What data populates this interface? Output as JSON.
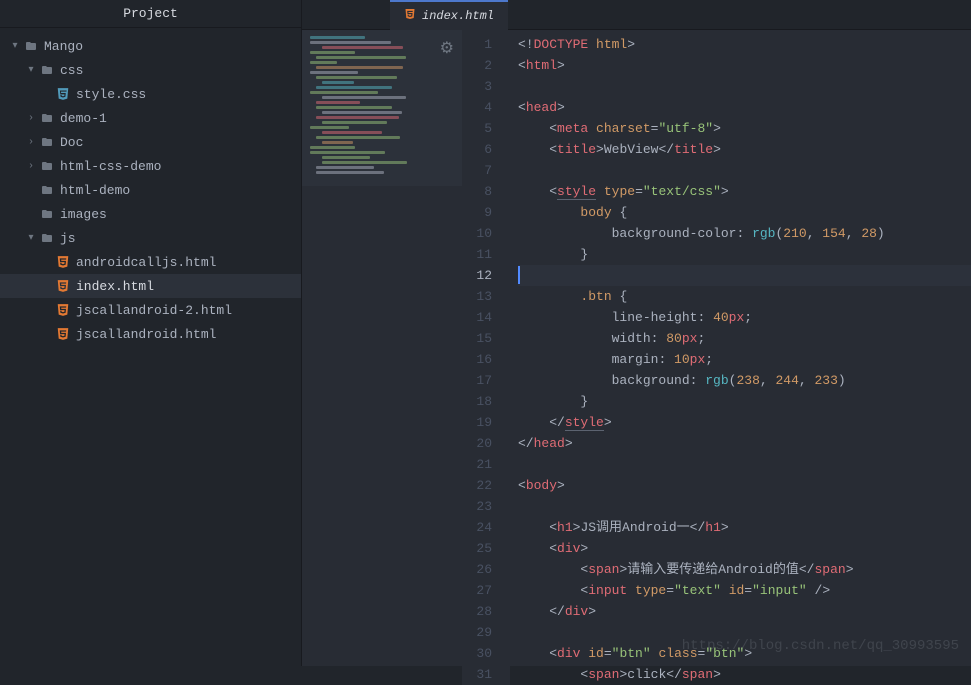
{
  "sidebar": {
    "title": "Project",
    "items": [
      {
        "label": "Mango",
        "type": "folder",
        "indent": 0,
        "expanded": true,
        "chev": "▾"
      },
      {
        "label": "css",
        "type": "folder",
        "indent": 1,
        "expanded": true,
        "chev": "▾"
      },
      {
        "label": "style.css",
        "type": "css",
        "indent": 2,
        "chev": ""
      },
      {
        "label": "demo-1",
        "type": "folder",
        "indent": 1,
        "expanded": false,
        "chev": "›"
      },
      {
        "label": "Doc",
        "type": "folder",
        "indent": 1,
        "expanded": false,
        "chev": "›"
      },
      {
        "label": "html-css-demo",
        "type": "folder",
        "indent": 1,
        "expanded": false,
        "chev": "›"
      },
      {
        "label": "html-demo",
        "type": "folder",
        "indent": 1,
        "expanded": false,
        "chev": ""
      },
      {
        "label": "images",
        "type": "folder",
        "indent": 1,
        "expanded": false,
        "chev": ""
      },
      {
        "label": "js",
        "type": "folder",
        "indent": 1,
        "expanded": true,
        "chev": "▾"
      },
      {
        "label": "androidcalljs.html",
        "type": "html",
        "indent": 2,
        "chev": ""
      },
      {
        "label": "index.html",
        "type": "html",
        "indent": 2,
        "chev": "",
        "selected": true
      },
      {
        "label": "jscallandroid-2.html",
        "type": "html",
        "indent": 2,
        "chev": ""
      },
      {
        "label": "jscallandroid.html",
        "type": "html",
        "indent": 2,
        "chev": ""
      }
    ]
  },
  "tab": {
    "label": "index.html"
  },
  "editor": {
    "current_line": 12,
    "lines": [
      {
        "n": 1,
        "t": "<!DOCTYPE html>",
        "seg": [
          [
            "<!",
            "p"
          ],
          [
            "DOCTYPE ",
            "t"
          ],
          [
            "html",
            "a"
          ],
          [
            ">",
            "p"
          ]
        ]
      },
      {
        "n": 2,
        "t": "<html>",
        "seg": [
          [
            "<",
            "p"
          ],
          [
            "html",
            "t"
          ],
          [
            ">",
            "p"
          ]
        ]
      },
      {
        "n": 3,
        "t": "",
        "seg": []
      },
      {
        "n": 4,
        "t": "<head>",
        "seg": [
          [
            "<",
            "p"
          ],
          [
            "head",
            "t"
          ],
          [
            ">",
            "p"
          ]
        ]
      },
      {
        "n": 5,
        "t": "    <meta charset=\"utf-8\">",
        "seg": [
          [
            "    <",
            "p"
          ],
          [
            "meta ",
            "t"
          ],
          [
            "charset",
            "a"
          ],
          [
            "=",
            "p"
          ],
          [
            "\"utf-8\"",
            "s"
          ],
          [
            ">",
            "p"
          ]
        ]
      },
      {
        "n": 6,
        "t": "    <title>WebView</title>",
        "seg": [
          [
            "    <",
            "p"
          ],
          [
            "title",
            "t"
          ],
          [
            ">",
            "p"
          ],
          [
            "WebView",
            "x"
          ],
          [
            "</",
            "p"
          ],
          [
            "title",
            "t"
          ],
          [
            ">",
            "p"
          ]
        ]
      },
      {
        "n": 7,
        "t": "",
        "seg": []
      },
      {
        "n": 8,
        "t": "    <style type=\"text/css\">",
        "seg": [
          [
            "    <",
            "p"
          ],
          [
            "style",
            "t_u"
          ],
          [
            " ",
            "p"
          ],
          [
            "type",
            "a"
          ],
          [
            "=",
            "p"
          ],
          [
            "\"text/css\"",
            "s"
          ],
          [
            ">",
            "p"
          ]
        ]
      },
      {
        "n": 9,
        "t": "        body {",
        "seg": [
          [
            "        ",
            "p"
          ],
          [
            "body ",
            "sel"
          ],
          [
            "{",
            "p"
          ]
        ]
      },
      {
        "n": 10,
        "t": "            background-color: rgb(210, 154, 28)",
        "seg": [
          [
            "            ",
            "p"
          ],
          [
            "background-color",
            "pr"
          ],
          [
            ": ",
            "p"
          ],
          [
            "rgb",
            "fn"
          ],
          [
            "(",
            "p"
          ],
          [
            "210",
            "n"
          ],
          [
            ", ",
            "p"
          ],
          [
            "154",
            "n"
          ],
          [
            ", ",
            "p"
          ],
          [
            "28",
            "n"
          ],
          [
            ")",
            "p"
          ]
        ]
      },
      {
        "n": 11,
        "t": "        }",
        "seg": [
          [
            "        }",
            "p"
          ]
        ]
      },
      {
        "n": 12,
        "t": "",
        "seg": []
      },
      {
        "n": 13,
        "t": "        .btn {",
        "seg": [
          [
            "        ",
            "p"
          ],
          [
            ".btn ",
            "sel"
          ],
          [
            "{",
            "p"
          ]
        ]
      },
      {
        "n": 14,
        "t": "            line-height: 40px;",
        "seg": [
          [
            "            ",
            "p"
          ],
          [
            "line-height",
            "pr"
          ],
          [
            ": ",
            "p"
          ],
          [
            "40",
            "n"
          ],
          [
            "px",
            "t"
          ],
          [
            ";",
            "p"
          ]
        ]
      },
      {
        "n": 15,
        "t": "            width: 80px;",
        "seg": [
          [
            "            ",
            "p"
          ],
          [
            "width",
            "pr"
          ],
          [
            ": ",
            "p"
          ],
          [
            "80",
            "n"
          ],
          [
            "px",
            "t"
          ],
          [
            ";",
            "p"
          ]
        ]
      },
      {
        "n": 16,
        "t": "            margin: 10px;",
        "seg": [
          [
            "            ",
            "p"
          ],
          [
            "margin",
            "pr"
          ],
          [
            ": ",
            "p"
          ],
          [
            "10",
            "n"
          ],
          [
            "px",
            "t"
          ],
          [
            ";",
            "p"
          ]
        ]
      },
      {
        "n": 17,
        "t": "            background: rgb(238, 244, 233)",
        "seg": [
          [
            "            ",
            "p"
          ],
          [
            "background",
            "pr"
          ],
          [
            ": ",
            "p"
          ],
          [
            "rgb",
            "fn"
          ],
          [
            "(",
            "p"
          ],
          [
            "238",
            "n"
          ],
          [
            ", ",
            "p"
          ],
          [
            "244",
            "n"
          ],
          [
            ", ",
            "p"
          ],
          [
            "233",
            "n"
          ],
          [
            ")",
            "p"
          ]
        ]
      },
      {
        "n": 18,
        "t": "        }",
        "seg": [
          [
            "        }",
            "p"
          ]
        ]
      },
      {
        "n": 19,
        "t": "    </style>",
        "seg": [
          [
            "    </",
            "p"
          ],
          [
            "style",
            "t_u"
          ],
          [
            ">",
            "p"
          ]
        ]
      },
      {
        "n": 20,
        "t": "</head>",
        "seg": [
          [
            "</",
            "p"
          ],
          [
            "head",
            "t"
          ],
          [
            ">",
            "p"
          ]
        ]
      },
      {
        "n": 21,
        "t": "",
        "seg": []
      },
      {
        "n": 22,
        "t": "<body>",
        "seg": [
          [
            "<",
            "p"
          ],
          [
            "body",
            "t"
          ],
          [
            ">",
            "p"
          ]
        ]
      },
      {
        "n": 23,
        "t": "",
        "seg": []
      },
      {
        "n": 24,
        "t": "    <h1>JS调用Android一</h1>",
        "seg": [
          [
            "    <",
            "p"
          ],
          [
            "h1",
            "t"
          ],
          [
            ">",
            "p"
          ],
          [
            "JS调用Android一",
            "x"
          ],
          [
            "</",
            "p"
          ],
          [
            "h1",
            "t"
          ],
          [
            ">",
            "p"
          ]
        ]
      },
      {
        "n": 25,
        "t": "    <div>",
        "seg": [
          [
            "    <",
            "p"
          ],
          [
            "div",
            "t"
          ],
          [
            ">",
            "p"
          ]
        ]
      },
      {
        "n": 26,
        "t": "        <span>请输入要传递给Android的值</span>",
        "seg": [
          [
            "        <",
            "p"
          ],
          [
            "span",
            "t"
          ],
          [
            ">",
            "p"
          ],
          [
            "请输入要传递给Android的值",
            "x"
          ],
          [
            "</",
            "p"
          ],
          [
            "span",
            "t"
          ],
          [
            ">",
            "p"
          ]
        ]
      },
      {
        "n": 27,
        "t": "        <input type=\"text\" id=\"input\" />",
        "seg": [
          [
            "        <",
            "p"
          ],
          [
            "input ",
            "t"
          ],
          [
            "type",
            "a"
          ],
          [
            "=",
            "p"
          ],
          [
            "\"text\"",
            "s"
          ],
          [
            " ",
            "p"
          ],
          [
            "id",
            "a"
          ],
          [
            "=",
            "p"
          ],
          [
            "\"input\"",
            "s"
          ],
          [
            " />",
            "p"
          ]
        ]
      },
      {
        "n": 28,
        "t": "    </div>",
        "seg": [
          [
            "    </",
            "p"
          ],
          [
            "div",
            "t"
          ],
          [
            ">",
            "p"
          ]
        ]
      },
      {
        "n": 29,
        "t": "",
        "seg": []
      },
      {
        "n": 30,
        "t": "    <div id=\"btn\" class=\"btn\">",
        "seg": [
          [
            "    <",
            "p"
          ],
          [
            "div ",
            "t"
          ],
          [
            "id",
            "a"
          ],
          [
            "=",
            "p"
          ],
          [
            "\"btn\"",
            "s"
          ],
          [
            " ",
            "p"
          ],
          [
            "class",
            "a"
          ],
          [
            "=",
            "p"
          ],
          [
            "\"btn\"",
            "s"
          ],
          [
            ">",
            "p"
          ]
        ]
      },
      {
        "n": 31,
        "t": "        <span>click</span>",
        "seg": [
          [
            "        <",
            "p"
          ],
          [
            "span",
            "t"
          ],
          [
            ">",
            "p"
          ],
          [
            "click",
            "x"
          ],
          [
            "</",
            "p"
          ],
          [
            "span",
            "t"
          ],
          [
            ">",
            "p"
          ]
        ]
      }
    ]
  },
  "watermark": "https://blog.csdn.net/qq_30993595"
}
